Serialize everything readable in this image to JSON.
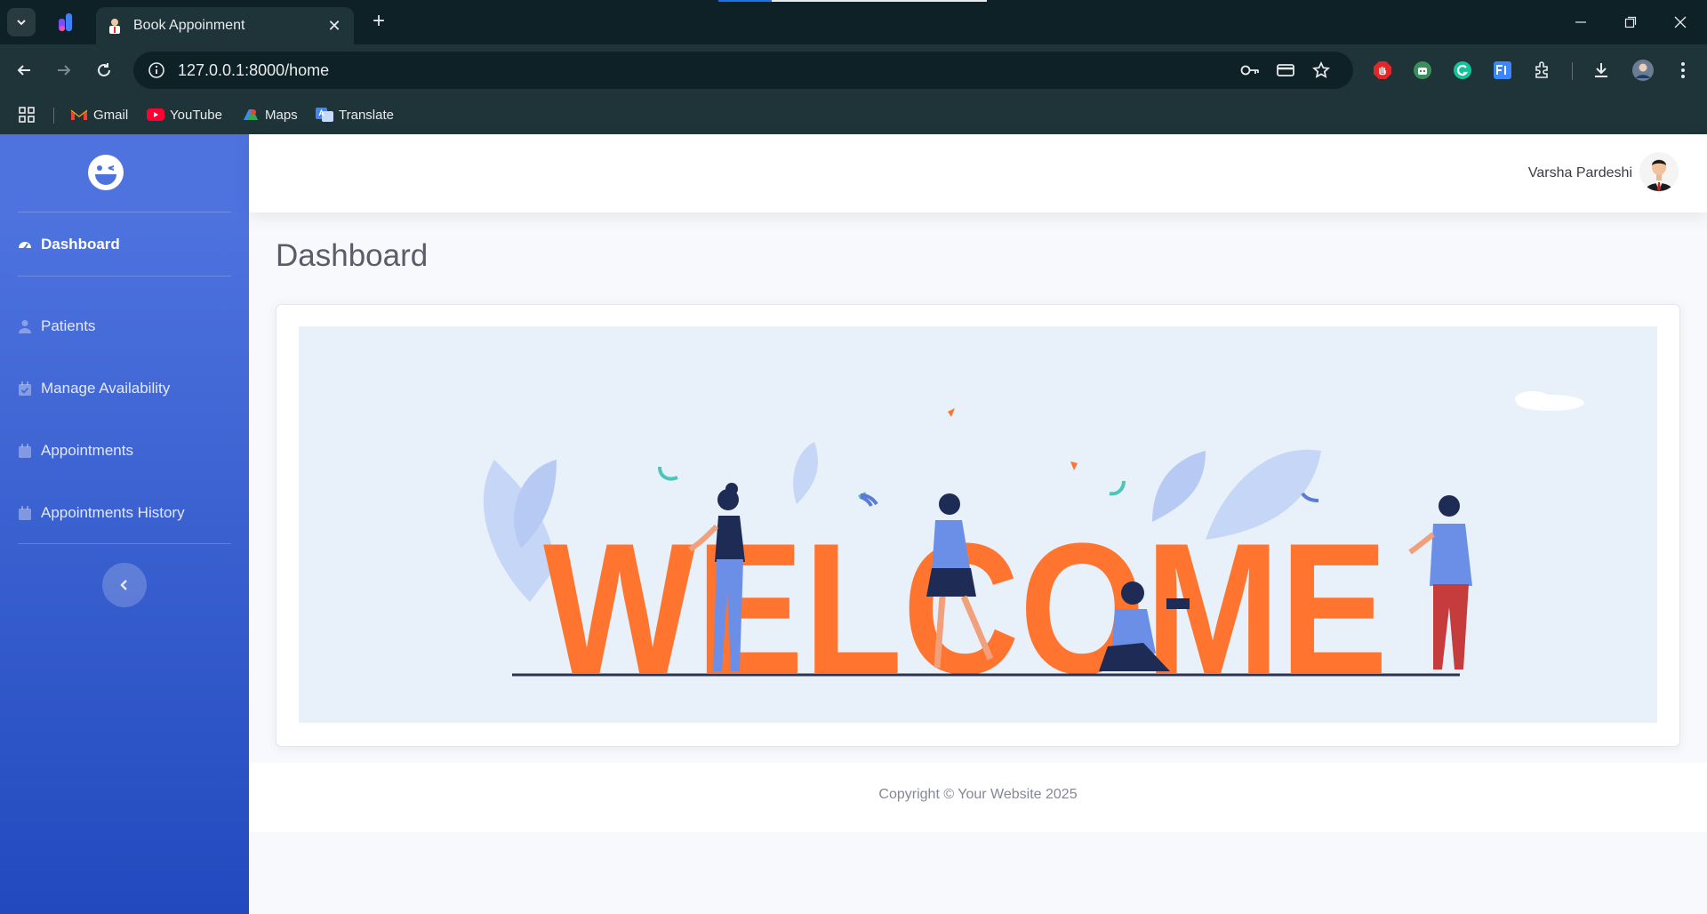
{
  "browser": {
    "tab_title": "Book Appoinment",
    "url": "127.0.0.1:8000/home",
    "bookmarks": [
      {
        "label": "Gmail",
        "icon": "gmail-icon"
      },
      {
        "label": "YouTube",
        "icon": "youtube-icon"
      },
      {
        "label": "Maps",
        "icon": "maps-icon"
      },
      {
        "label": "Translate",
        "icon": "translate-icon"
      }
    ]
  },
  "sidebar": {
    "items": [
      {
        "label": "Dashboard",
        "icon": "dashboard-icon",
        "active": true
      },
      {
        "label": "Patients",
        "icon": "user-icon"
      },
      {
        "label": "Manage Availability",
        "icon": "calendar-check-icon"
      },
      {
        "label": "Appointments",
        "icon": "calendar-icon"
      },
      {
        "label": "Appointments History",
        "icon": "calendar-icon"
      }
    ]
  },
  "topbar": {
    "user_name": "Varsha Pardeshi"
  },
  "main": {
    "page_title": "Dashboard",
    "banner_text": "WELCOME"
  },
  "footer": {
    "copyright": "Copyright © Your Website 2025"
  },
  "colors": {
    "sidebar_top": "#4e73df",
    "sidebar_bottom": "#224abe",
    "welcome_orange": "#ff7530",
    "banner_bg": "#e8f1fa"
  }
}
